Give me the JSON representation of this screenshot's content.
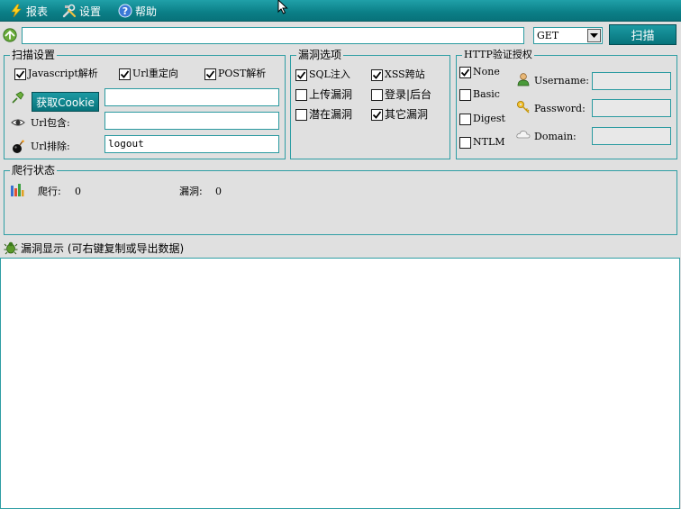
{
  "menu": {
    "items": [
      {
        "label": "报表",
        "icon": "lightning-icon"
      },
      {
        "label": "设置",
        "icon": "tools-icon"
      },
      {
        "label": "帮助",
        "icon": "help-icon"
      }
    ]
  },
  "url_bar": {
    "value": "",
    "method": "GET",
    "scan_label": "扫描"
  },
  "scan_settings": {
    "title": "扫描设置",
    "options": [
      {
        "label": "Javascript解析",
        "checked": true
      },
      {
        "label": "Url重定向",
        "checked": true
      },
      {
        "label": "POST解析",
        "checked": true
      }
    ],
    "cookie_button": "获取Cookie",
    "cookie_value": "",
    "url_include_label": "Url包含:",
    "url_include_value": "",
    "url_exclude_label": "Url排除:",
    "url_exclude_value": "logout"
  },
  "vuln_options": {
    "title": "漏洞选项",
    "items": [
      {
        "label": "SQL注入",
        "checked": true
      },
      {
        "label": "XSS跨站",
        "checked": true
      },
      {
        "label": "上传漏洞",
        "checked": false
      },
      {
        "label": "登录|后台",
        "checked": false
      },
      {
        "label": "潜在漏洞",
        "checked": false
      },
      {
        "label": "其它漏洞",
        "checked": true
      }
    ]
  },
  "http_auth": {
    "title": "HTTP验证授权",
    "types": [
      {
        "label": "None",
        "checked": true
      },
      {
        "label": "Basic",
        "checked": false
      },
      {
        "label": "Digest",
        "checked": false
      },
      {
        "label": "NTLM",
        "checked": false
      }
    ],
    "username_label": "Username:",
    "password_label": "Password:",
    "domain_label": "Domain:",
    "username_value": "",
    "password_value": "",
    "domain_value": ""
  },
  "crawl_status": {
    "title": "爬行状态",
    "crawl_label": "爬行:",
    "crawl_count": "0",
    "vuln_label": "漏洞:",
    "vuln_count": "0"
  },
  "results": {
    "title": "漏洞显示 (可右键复制或导出数据)"
  },
  "colors": {
    "accent": "#0b7f87",
    "border": "#2e9ea4",
    "background": "#e0e0e0"
  }
}
